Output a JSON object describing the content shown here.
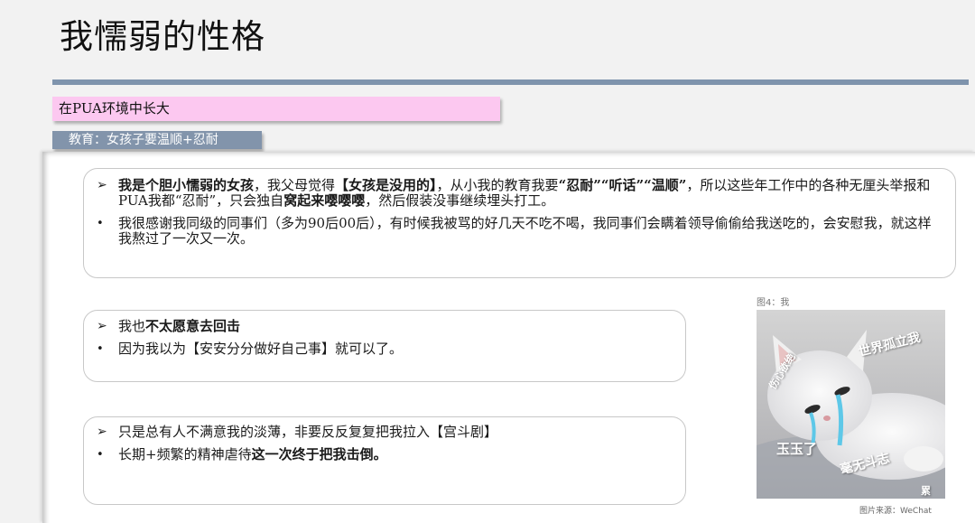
{
  "header": {
    "title": "我懦弱的性格"
  },
  "tags": {
    "section": "在PUA环境中长大",
    "education": "教育：女孩子要温顺+忍耐"
  },
  "card1": {
    "p1_a": "我是个胆小懦弱的女孩",
    "p1_b": "，我父母觉得",
    "p1_c": "【女孩是没用的】",
    "p1_d": "，从小我的教育我要",
    "p1_e": "“忍耐”“听话”“温顺”",
    "p1_f": "，所以这些年工作中的各种无厘头举报和PUA我都“忍耐”，只会独自",
    "p1_g": "窝起来嘤嘤嘤",
    "p1_h": "，然后假装没事继续埋头打工。",
    "p2": "我很感谢我同级的同事们（多为90后00后），有时候我被骂的好几天不吃不喝，我同事们会瞒着领导偷偷给我送吃的，会安慰我，就这样我熬过了一次又一次。"
  },
  "card2": {
    "p1_a": "我也",
    "p1_b": "不太愿意去回击",
    "p2": "因为我以为【安安分分做好自己事】就可以了。"
  },
  "card3": {
    "p1": "只是总有人不满意我的淡薄，非要反反复复把我拉入【宫斗剧】",
    "p2_a": "长期+频繁的精神虐待",
    "p2_b": "这一次终于把我击倒。"
  },
  "figure": {
    "caption": "图4：我",
    "source": "图片来源：WeChat",
    "meme_text": {
      "line1": "世界孤立我",
      "line2": "伤心欲绝",
      "line3": "玉玉了",
      "line4": "毫无斗志",
      "line5": "累"
    }
  },
  "markers": {
    "arrow": "➢",
    "bullet": "•"
  }
}
